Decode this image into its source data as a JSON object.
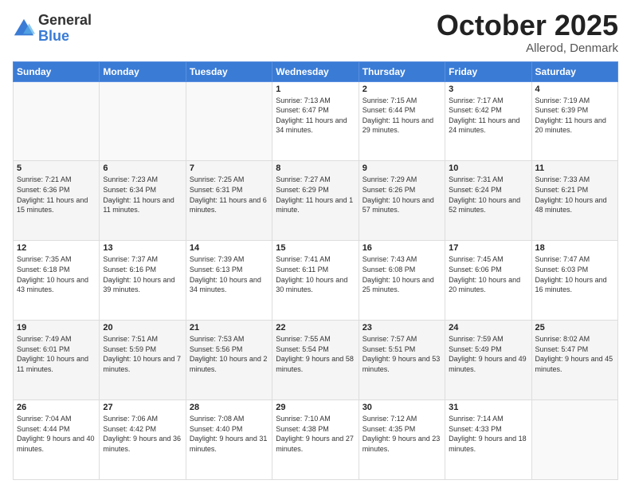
{
  "logo": {
    "general": "General",
    "blue": "Blue"
  },
  "title": "October 2025",
  "location": "Allerod, Denmark",
  "days_of_week": [
    "Sunday",
    "Monday",
    "Tuesday",
    "Wednesday",
    "Thursday",
    "Friday",
    "Saturday"
  ],
  "weeks": [
    [
      {
        "day": "",
        "sunrise": "",
        "sunset": "",
        "daylight": ""
      },
      {
        "day": "",
        "sunrise": "",
        "sunset": "",
        "daylight": ""
      },
      {
        "day": "",
        "sunrise": "",
        "sunset": "",
        "daylight": ""
      },
      {
        "day": "1",
        "sunrise": "Sunrise: 7:13 AM",
        "sunset": "Sunset: 6:47 PM",
        "daylight": "Daylight: 11 hours and 34 minutes."
      },
      {
        "day": "2",
        "sunrise": "Sunrise: 7:15 AM",
        "sunset": "Sunset: 6:44 PM",
        "daylight": "Daylight: 11 hours and 29 minutes."
      },
      {
        "day": "3",
        "sunrise": "Sunrise: 7:17 AM",
        "sunset": "Sunset: 6:42 PM",
        "daylight": "Daylight: 11 hours and 24 minutes."
      },
      {
        "day": "4",
        "sunrise": "Sunrise: 7:19 AM",
        "sunset": "Sunset: 6:39 PM",
        "daylight": "Daylight: 11 hours and 20 minutes."
      }
    ],
    [
      {
        "day": "5",
        "sunrise": "Sunrise: 7:21 AM",
        "sunset": "Sunset: 6:36 PM",
        "daylight": "Daylight: 11 hours and 15 minutes."
      },
      {
        "day": "6",
        "sunrise": "Sunrise: 7:23 AM",
        "sunset": "Sunset: 6:34 PM",
        "daylight": "Daylight: 11 hours and 11 minutes."
      },
      {
        "day": "7",
        "sunrise": "Sunrise: 7:25 AM",
        "sunset": "Sunset: 6:31 PM",
        "daylight": "Daylight: 11 hours and 6 minutes."
      },
      {
        "day": "8",
        "sunrise": "Sunrise: 7:27 AM",
        "sunset": "Sunset: 6:29 PM",
        "daylight": "Daylight: 11 hours and 1 minute."
      },
      {
        "day": "9",
        "sunrise": "Sunrise: 7:29 AM",
        "sunset": "Sunset: 6:26 PM",
        "daylight": "Daylight: 10 hours and 57 minutes."
      },
      {
        "day": "10",
        "sunrise": "Sunrise: 7:31 AM",
        "sunset": "Sunset: 6:24 PM",
        "daylight": "Daylight: 10 hours and 52 minutes."
      },
      {
        "day": "11",
        "sunrise": "Sunrise: 7:33 AM",
        "sunset": "Sunset: 6:21 PM",
        "daylight": "Daylight: 10 hours and 48 minutes."
      }
    ],
    [
      {
        "day": "12",
        "sunrise": "Sunrise: 7:35 AM",
        "sunset": "Sunset: 6:18 PM",
        "daylight": "Daylight: 10 hours and 43 minutes."
      },
      {
        "day": "13",
        "sunrise": "Sunrise: 7:37 AM",
        "sunset": "Sunset: 6:16 PM",
        "daylight": "Daylight: 10 hours and 39 minutes."
      },
      {
        "day": "14",
        "sunrise": "Sunrise: 7:39 AM",
        "sunset": "Sunset: 6:13 PM",
        "daylight": "Daylight: 10 hours and 34 minutes."
      },
      {
        "day": "15",
        "sunrise": "Sunrise: 7:41 AM",
        "sunset": "Sunset: 6:11 PM",
        "daylight": "Daylight: 10 hours and 30 minutes."
      },
      {
        "day": "16",
        "sunrise": "Sunrise: 7:43 AM",
        "sunset": "Sunset: 6:08 PM",
        "daylight": "Daylight: 10 hours and 25 minutes."
      },
      {
        "day": "17",
        "sunrise": "Sunrise: 7:45 AM",
        "sunset": "Sunset: 6:06 PM",
        "daylight": "Daylight: 10 hours and 20 minutes."
      },
      {
        "day": "18",
        "sunrise": "Sunrise: 7:47 AM",
        "sunset": "Sunset: 6:03 PM",
        "daylight": "Daylight: 10 hours and 16 minutes."
      }
    ],
    [
      {
        "day": "19",
        "sunrise": "Sunrise: 7:49 AM",
        "sunset": "Sunset: 6:01 PM",
        "daylight": "Daylight: 10 hours and 11 minutes."
      },
      {
        "day": "20",
        "sunrise": "Sunrise: 7:51 AM",
        "sunset": "Sunset: 5:59 PM",
        "daylight": "Daylight: 10 hours and 7 minutes."
      },
      {
        "day": "21",
        "sunrise": "Sunrise: 7:53 AM",
        "sunset": "Sunset: 5:56 PM",
        "daylight": "Daylight: 10 hours and 2 minutes."
      },
      {
        "day": "22",
        "sunrise": "Sunrise: 7:55 AM",
        "sunset": "Sunset: 5:54 PM",
        "daylight": "Daylight: 9 hours and 58 minutes."
      },
      {
        "day": "23",
        "sunrise": "Sunrise: 7:57 AM",
        "sunset": "Sunset: 5:51 PM",
        "daylight": "Daylight: 9 hours and 53 minutes."
      },
      {
        "day": "24",
        "sunrise": "Sunrise: 7:59 AM",
        "sunset": "Sunset: 5:49 PM",
        "daylight": "Daylight: 9 hours and 49 minutes."
      },
      {
        "day": "25",
        "sunrise": "Sunrise: 8:02 AM",
        "sunset": "Sunset: 5:47 PM",
        "daylight": "Daylight: 9 hours and 45 minutes."
      }
    ],
    [
      {
        "day": "26",
        "sunrise": "Sunrise: 7:04 AM",
        "sunset": "Sunset: 4:44 PM",
        "daylight": "Daylight: 9 hours and 40 minutes."
      },
      {
        "day": "27",
        "sunrise": "Sunrise: 7:06 AM",
        "sunset": "Sunset: 4:42 PM",
        "daylight": "Daylight: 9 hours and 36 minutes."
      },
      {
        "day": "28",
        "sunrise": "Sunrise: 7:08 AM",
        "sunset": "Sunset: 4:40 PM",
        "daylight": "Daylight: 9 hours and 31 minutes."
      },
      {
        "day": "29",
        "sunrise": "Sunrise: 7:10 AM",
        "sunset": "Sunset: 4:38 PM",
        "daylight": "Daylight: 9 hours and 27 minutes."
      },
      {
        "day": "30",
        "sunrise": "Sunrise: 7:12 AM",
        "sunset": "Sunset: 4:35 PM",
        "daylight": "Daylight: 9 hours and 23 minutes."
      },
      {
        "day": "31",
        "sunrise": "Sunrise: 7:14 AM",
        "sunset": "Sunset: 4:33 PM",
        "daylight": "Daylight: 9 hours and 18 minutes."
      },
      {
        "day": "",
        "sunrise": "",
        "sunset": "",
        "daylight": ""
      }
    ]
  ]
}
